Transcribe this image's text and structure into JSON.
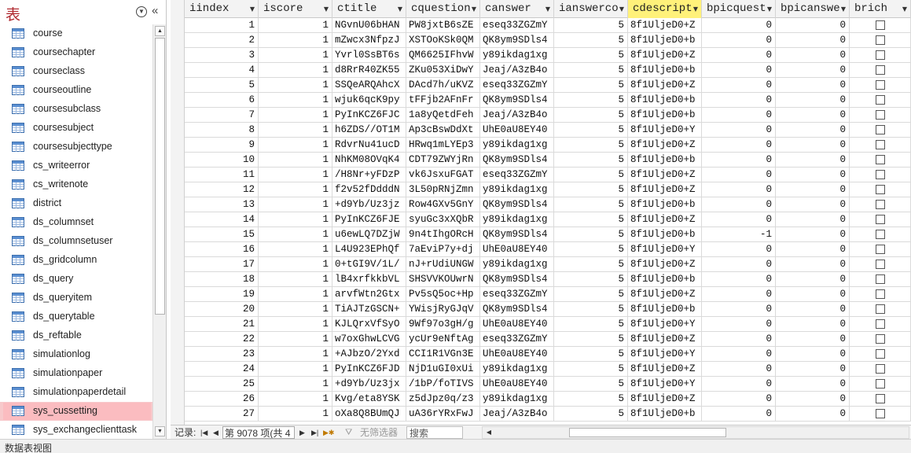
{
  "nav": {
    "title": "表",
    "items": [
      {
        "label": "course"
      },
      {
        "label": "coursechapter"
      },
      {
        "label": "courseclass"
      },
      {
        "label": "courseoutline"
      },
      {
        "label": "coursesubclass"
      },
      {
        "label": "coursesubject"
      },
      {
        "label": "coursesubjecttype"
      },
      {
        "label": "cs_writeerror"
      },
      {
        "label": "cs_writenote"
      },
      {
        "label": "district"
      },
      {
        "label": "ds_columnset"
      },
      {
        "label": "ds_columnsetuser"
      },
      {
        "label": "ds_gridcolumn"
      },
      {
        "label": "ds_query"
      },
      {
        "label": "ds_queryitem"
      },
      {
        "label": "ds_querytable"
      },
      {
        "label": "ds_reftable"
      },
      {
        "label": "simulationlog"
      },
      {
        "label": "simulationpaper"
      },
      {
        "label": "simulationpaperdetail"
      },
      {
        "label": "sys_cussetting",
        "selected": true
      },
      {
        "label": "sys_exchangeclienttask"
      }
    ]
  },
  "columns": [
    {
      "name": "iindex",
      "type": "num"
    },
    {
      "name": "iscore",
      "type": "num"
    },
    {
      "name": "ctitle",
      "type": "txt"
    },
    {
      "name": "cquestion",
      "type": "txt"
    },
    {
      "name": "canswer",
      "type": "txt"
    },
    {
      "name": "ianswerco",
      "type": "num"
    },
    {
      "name": "cdescript",
      "type": "txt",
      "sorted": true
    },
    {
      "name": "bpicquest",
      "type": "num"
    },
    {
      "name": "bpicanswe",
      "type": "num"
    },
    {
      "name": "brich",
      "type": "chk"
    }
  ],
  "rows": [
    [
      "1",
      "1",
      "NGvnU06bHAN",
      "PW8jxtB6sZE",
      "eseq33ZGZmY",
      "5",
      "8f1UljeD0+Z",
      "0",
      "0",
      ""
    ],
    [
      "2",
      "1",
      "mZwcx3NfpzJ",
      "XSTOoKSk0QM",
      "QK8ym9SDls4",
      "5",
      "8f1UljeD0+b",
      "0",
      "0",
      ""
    ],
    [
      "3",
      "1",
      "Yvrl0SsBT6s",
      "QM6625IFhvW",
      "y89ikdag1xg",
      "5",
      "8f1UljeD0+Z",
      "0",
      "0",
      ""
    ],
    [
      "4",
      "1",
      "d8RrR40ZK55",
      "ZKu053XiDwY",
      "Jeaj/A3zB4o",
      "5",
      "8f1UljeD0+b",
      "0",
      "0",
      ""
    ],
    [
      "5",
      "1",
      "SSQeARQAhcX",
      "DAcd7h/uKVZ",
      "eseq33ZGZmY",
      "5",
      "8f1UljeD0+Z",
      "0",
      "0",
      ""
    ],
    [
      "6",
      "1",
      "wjuk6qcK9py",
      "tFFjb2AFnFr",
      "QK8ym9SDls4",
      "5",
      "8f1UljeD0+b",
      "0",
      "0",
      ""
    ],
    [
      "7",
      "1",
      "PyInKCZ6FJC",
      "1a8yQetdFeh",
      "Jeaj/A3zB4o",
      "5",
      "8f1UljeD0+b",
      "0",
      "0",
      ""
    ],
    [
      "8",
      "1",
      "h6ZDS//OT1M",
      "Ap3cBswDdXt",
      "UhE0aU8EY40",
      "5",
      "8f1UljeD0+Y",
      "0",
      "0",
      ""
    ],
    [
      "9",
      "1",
      "RdvrNu41ucD",
      "HRwq1mLYEp3",
      "y89ikdag1xg",
      "5",
      "8f1UljeD0+Z",
      "0",
      "0",
      ""
    ],
    [
      "10",
      "1",
      "NhKM08OVqK4",
      "CDT79ZWYjRn",
      "QK8ym9SDls4",
      "5",
      "8f1UljeD0+b",
      "0",
      "0",
      ""
    ],
    [
      "11",
      "1",
      "/H8Nr+yFDzP",
      "vk6JsxuFGAT",
      "eseq33ZGZmY",
      "5",
      "8f1UljeD0+Z",
      "0",
      "0",
      ""
    ],
    [
      "12",
      "1",
      "f2v52fDdddN",
      "3L50pRNjZmn",
      "y89ikdag1xg",
      "5",
      "8f1UljeD0+Z",
      "0",
      "0",
      ""
    ],
    [
      "13",
      "1",
      "+d9Yb/Uz3jz",
      "Row4GXv5GnY",
      "QK8ym9SDls4",
      "5",
      "8f1UljeD0+b",
      "0",
      "0",
      ""
    ],
    [
      "14",
      "1",
      "PyInKCZ6FJE",
      "syuGc3xXQbR",
      "y89ikdag1xg",
      "5",
      "8f1UljeD0+Z",
      "0",
      "0",
      ""
    ],
    [
      "15",
      "1",
      "u6ewLQ7DZjW",
      "9n4tIhgORcH",
      "QK8ym9SDls4",
      "5",
      "8f1UljeD0+b",
      "-1",
      "0",
      ""
    ],
    [
      "16",
      "1",
      "L4U923EPhQf",
      "7aEviP7y+dj",
      "UhE0aU8EY40",
      "5",
      "8f1UljeD0+Y",
      "0",
      "0",
      ""
    ],
    [
      "17",
      "1",
      "0+tGI9V/1L/",
      "nJ+rUdiUNGW",
      "y89ikdag1xg",
      "5",
      "8f1UljeD0+Z",
      "0",
      "0",
      ""
    ],
    [
      "18",
      "1",
      "lB4xrfkkbVL",
      "SHSVVKOUwrN",
      "QK8ym9SDls4",
      "5",
      "8f1UljeD0+b",
      "0",
      "0",
      ""
    ],
    [
      "19",
      "1",
      "arvfWtn2Gtx",
      "Pv5sQ5oc+Hp",
      "eseq33ZGZmY",
      "5",
      "8f1UljeD0+Z",
      "0",
      "0",
      ""
    ],
    [
      "20",
      "1",
      "TiAJTzGSCN+",
      "YWisjRyGJqV",
      "QK8ym9SDls4",
      "5",
      "8f1UljeD0+b",
      "0",
      "0",
      ""
    ],
    [
      "21",
      "1",
      "KJLQrxVfSyO",
      "9Wf97o3gH/g",
      "UhE0aU8EY40",
      "5",
      "8f1UljeD0+Y",
      "0",
      "0",
      ""
    ],
    [
      "22",
      "1",
      "w7oxGhwLCVG",
      "ycUr9eNftAg",
      "eseq33ZGZmY",
      "5",
      "8f1UljeD0+Z",
      "0",
      "0",
      ""
    ],
    [
      "23",
      "1",
      "+AJbzO/2Yxd",
      "CCI1R1VGn3E",
      "UhE0aU8EY40",
      "5",
      "8f1UljeD0+Y",
      "0",
      "0",
      ""
    ],
    [
      "24",
      "1",
      "PyInKCZ6FJD",
      "NjD1uGI0xUi",
      "y89ikdag1xg",
      "5",
      "8f1UljeD0+Z",
      "0",
      "0",
      ""
    ],
    [
      "25",
      "1",
      "+d9Yb/Uz3jx",
      "/1bP/foTIVS",
      "UhE0aU8EY40",
      "5",
      "8f1UljeD0+Y",
      "0",
      "0",
      ""
    ],
    [
      "26",
      "1",
      "Kvg/eta8YSK",
      "z5dJpz0q/z3",
      "y89ikdag1xg",
      "5",
      "8f1UljeD0+Z",
      "0",
      "0",
      ""
    ],
    [
      "27",
      "1",
      "oXa8Q8BUmQJ",
      "uA36rYRxFwJ",
      "Jeaj/A3zB4o",
      "5",
      "8f1UljeD0+b",
      "0",
      "0",
      ""
    ]
  ],
  "recordbar": {
    "label": "记录:",
    "current": "第 9078 项(共 4",
    "filter": "无筛选器",
    "search": "搜索"
  },
  "status": {
    "text": "数据表视图"
  }
}
